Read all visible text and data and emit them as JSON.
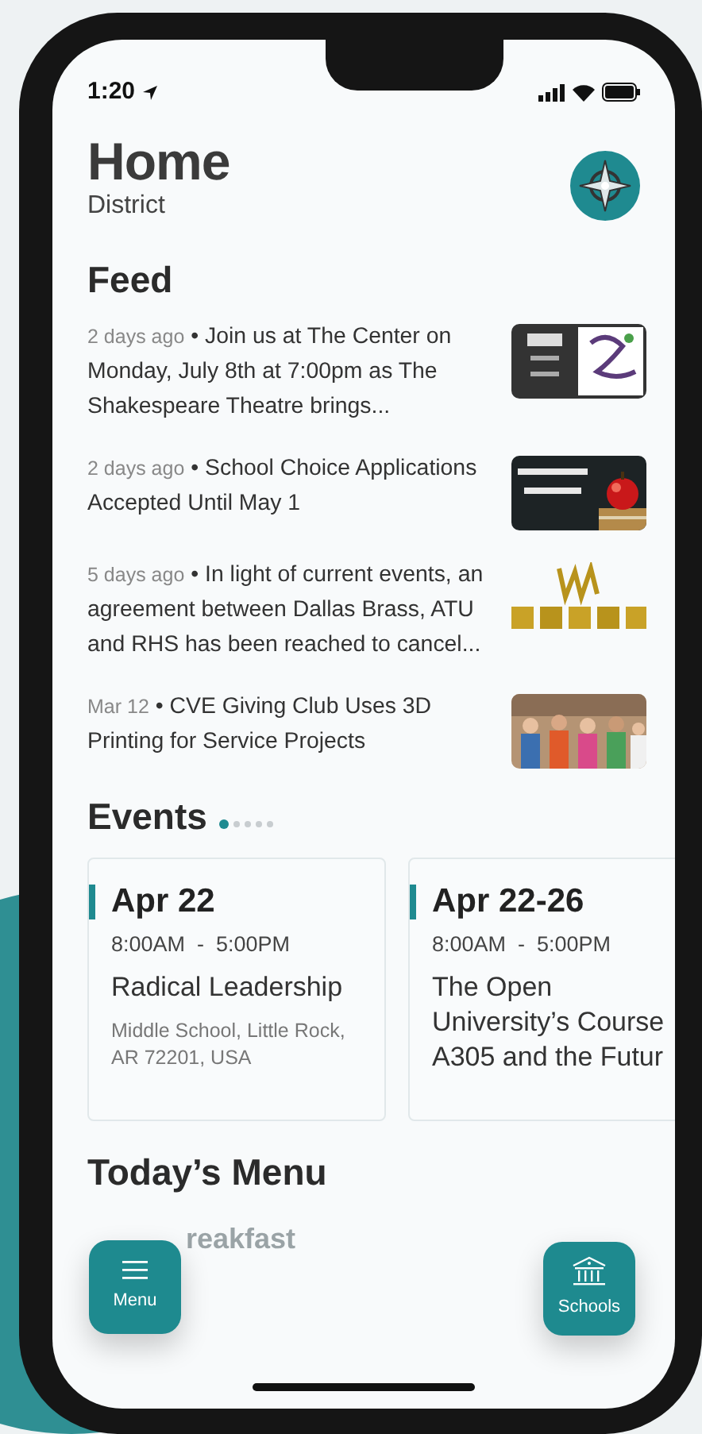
{
  "status_bar": {
    "time": "1:20"
  },
  "header": {
    "title": "Home",
    "subtitle": "District"
  },
  "feed": {
    "title": "Feed",
    "items": [
      {
        "age": "2 days ago",
        "separator": "•",
        "text": "Join us at The Center on Monday, July 8th at 7:00pm as The Shakespeare Theatre brings..."
      },
      {
        "age": "2 days ago",
        "separator": "•",
        "text": "School Choice Applications Accepted Until May 1"
      },
      {
        "age": "5 days ago",
        "separator": "•",
        "text": "In light of current events, an agreement between Dallas Brass, ATU and RHS has been reached to cancel..."
      },
      {
        "age": "Mar 12",
        "separator": "•",
        "text": "CVE Giving Club Uses 3D Printing for Service Projects"
      }
    ]
  },
  "events": {
    "title": "Events",
    "pager": [
      {
        "selected": true
      },
      {
        "selected": false
      },
      {
        "selected": false
      },
      {
        "selected": false
      },
      {
        "selected": false
      }
    ],
    "items": [
      {
        "date": "Apr 22",
        "time": "8:00AM  -  5:00PM",
        "name": "Radical Leadership",
        "location": "Middle School, Little Rock, AR 72201, USA"
      },
      {
        "date": "Apr 22-26",
        "time": "8:00AM  -  5:00PM",
        "name": "The Open University’s Course A305 and the Futur"
      }
    ]
  },
  "todays_menu": {
    "title": "Today’s Menu",
    "visible_item": "reakfast"
  },
  "buttons": [
    {
      "kind": "menu",
      "label": "Menu"
    },
    {
      "kind": "schools",
      "label": "Schools"
    }
  ]
}
